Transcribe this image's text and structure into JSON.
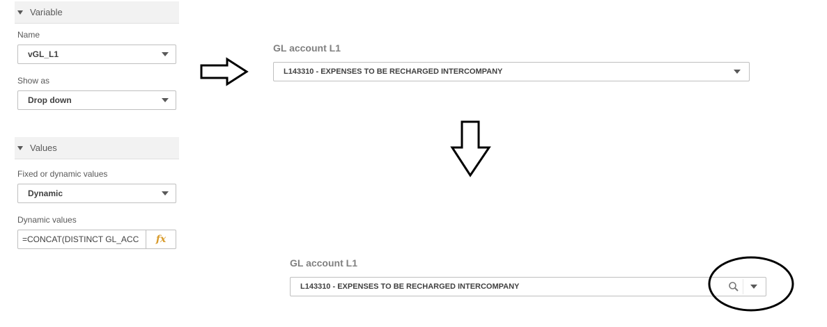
{
  "variable_panel": {
    "section_title": "Variable",
    "name_label": "Name",
    "name_value": "vGL_L1",
    "show_as_label": "Show as",
    "show_as_value": "Drop down"
  },
  "values_panel": {
    "section_title": "Values",
    "fixed_dynamic_label": "Fixed or dynamic values",
    "fixed_dynamic_value": "Dynamic",
    "dynamic_values_label": "Dynamic values",
    "dynamic_values_expression": "=CONCAT(DISTINCT GL_ACC",
    "fx_label": "fx"
  },
  "preview_top": {
    "title": "GL account L1",
    "selected": "L143310 - EXPENSES TO BE RECHARGED INTERCOMPANY"
  },
  "preview_bottom": {
    "title": "GL account L1",
    "selected": "L143310 - EXPENSES TO BE RECHARGED INTERCOMPANY"
  },
  "icons": [
    "chevron-down-icon",
    "search-icon",
    "fx-icon",
    "arrow-right-icon",
    "arrow-down-icon",
    "highlight-circle"
  ],
  "colors": {
    "fx": "#d89b2c",
    "border": "#bfbfbf",
    "header_bg": "#f2f2f2"
  }
}
